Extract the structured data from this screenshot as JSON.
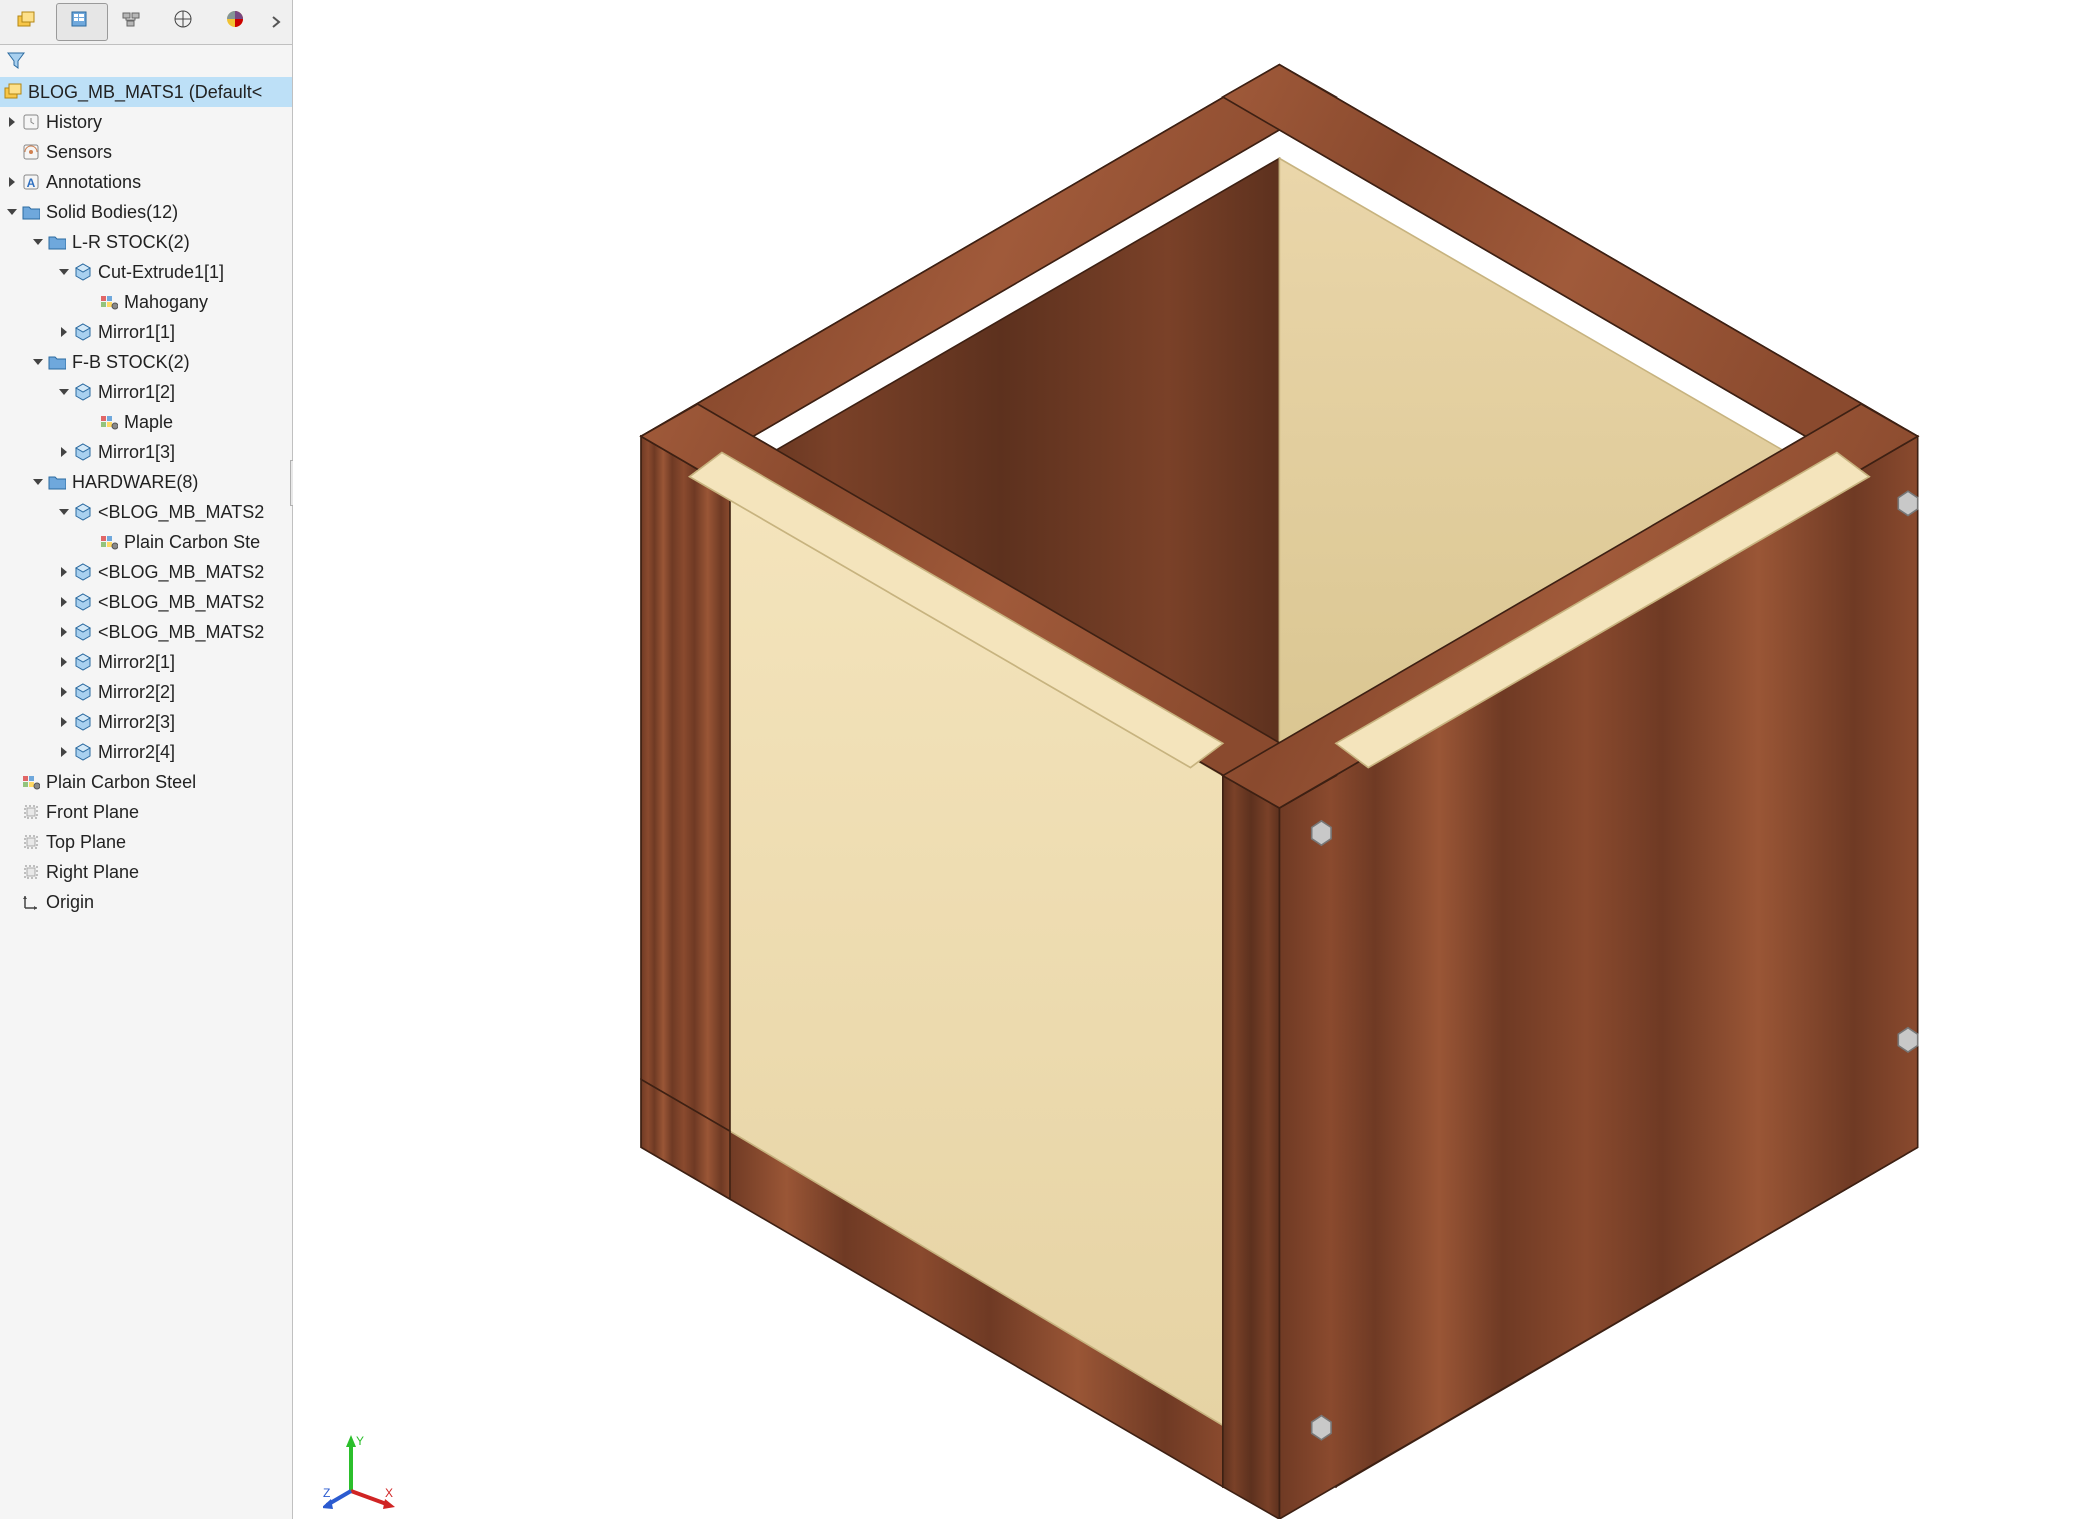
{
  "tabs": {
    "active_index": 1
  },
  "tree": {
    "root": {
      "label": "BLOG_MB_MATS1  (Default<"
    },
    "items": [
      {
        "id": "history",
        "label": "History",
        "level": 1,
        "twist": "closed",
        "icon": "history"
      },
      {
        "id": "sensors",
        "label": "Sensors",
        "level": 1,
        "twist": "none",
        "icon": "sensors"
      },
      {
        "id": "annotations",
        "label": "Annotations",
        "level": 1,
        "twist": "closed",
        "icon": "annot"
      },
      {
        "id": "solidbodies",
        "label": "Solid Bodies(12)",
        "level": 1,
        "twist": "open",
        "icon": "folder"
      },
      {
        "id": "lrstock",
        "label": "L-R STOCK(2)",
        "level": 2,
        "twist": "open",
        "icon": "folder"
      },
      {
        "id": "cutex1",
        "label": "Cut-Extrude1[1]",
        "level": 3,
        "twist": "open",
        "icon": "body"
      },
      {
        "id": "mahogany",
        "label": "Mahogany",
        "level": 4,
        "twist": "none",
        "icon": "material"
      },
      {
        "id": "mirror1_1",
        "label": "Mirror1[1]",
        "level": 3,
        "twist": "closed",
        "icon": "body"
      },
      {
        "id": "fbstock",
        "label": "F-B STOCK(2)",
        "level": 2,
        "twist": "open",
        "icon": "folder"
      },
      {
        "id": "mirror1_2",
        "label": "Mirror1[2]",
        "level": 3,
        "twist": "open",
        "icon": "body"
      },
      {
        "id": "maple",
        "label": "Maple",
        "level": 4,
        "twist": "none",
        "icon": "material"
      },
      {
        "id": "mirror1_3",
        "label": "Mirror1[3]",
        "level": 3,
        "twist": "closed",
        "icon": "body"
      },
      {
        "id": "hardware",
        "label": "HARDWARE(8)",
        "level": 2,
        "twist": "open",
        "icon": "folder"
      },
      {
        "id": "hw1",
        "label": "<BLOG_MB_MATS2",
        "level": 3,
        "twist": "open",
        "icon": "body"
      },
      {
        "id": "pcs",
        "label": "Plain Carbon Ste",
        "level": 4,
        "twist": "none",
        "icon": "material"
      },
      {
        "id": "hw2",
        "label": "<BLOG_MB_MATS2",
        "level": 3,
        "twist": "closed",
        "icon": "body"
      },
      {
        "id": "hw3",
        "label": "<BLOG_MB_MATS2",
        "level": 3,
        "twist": "closed",
        "icon": "body"
      },
      {
        "id": "hw4",
        "label": "<BLOG_MB_MATS2",
        "level": 3,
        "twist": "closed",
        "icon": "body"
      },
      {
        "id": "mirror2_1",
        "label": "Mirror2[1]",
        "level": 3,
        "twist": "closed",
        "icon": "body"
      },
      {
        "id": "mirror2_2",
        "label": "Mirror2[2]",
        "level": 3,
        "twist": "closed",
        "icon": "body"
      },
      {
        "id": "mirror2_3",
        "label": "Mirror2[3]",
        "level": 3,
        "twist": "closed",
        "icon": "body"
      },
      {
        "id": "mirror2_4",
        "label": "Mirror2[4]",
        "level": 3,
        "twist": "closed",
        "icon": "body"
      },
      {
        "id": "topmat",
        "label": "Plain Carbon Steel",
        "level": 1,
        "twist": "none",
        "icon": "material"
      },
      {
        "id": "frontplane",
        "label": "Front Plane",
        "level": 1,
        "twist": "none",
        "icon": "plane"
      },
      {
        "id": "topplane",
        "label": "Top Plane",
        "level": 1,
        "twist": "none",
        "icon": "plane"
      },
      {
        "id": "rightplane",
        "label": "Right Plane",
        "level": 1,
        "twist": "none",
        "icon": "plane"
      },
      {
        "id": "origin",
        "label": "Origin",
        "level": 1,
        "twist": "none",
        "icon": "origin"
      }
    ]
  },
  "triad": {
    "x_label": "X",
    "y_label": "Y",
    "z_label": "Z"
  },
  "colors": {
    "mahogany": "#8a4a2e",
    "mahogany_dark": "#6f3a24",
    "maple": "#f2e0b8",
    "maple_dark": "#e4cf9f",
    "steel": "#c0c0c0"
  }
}
